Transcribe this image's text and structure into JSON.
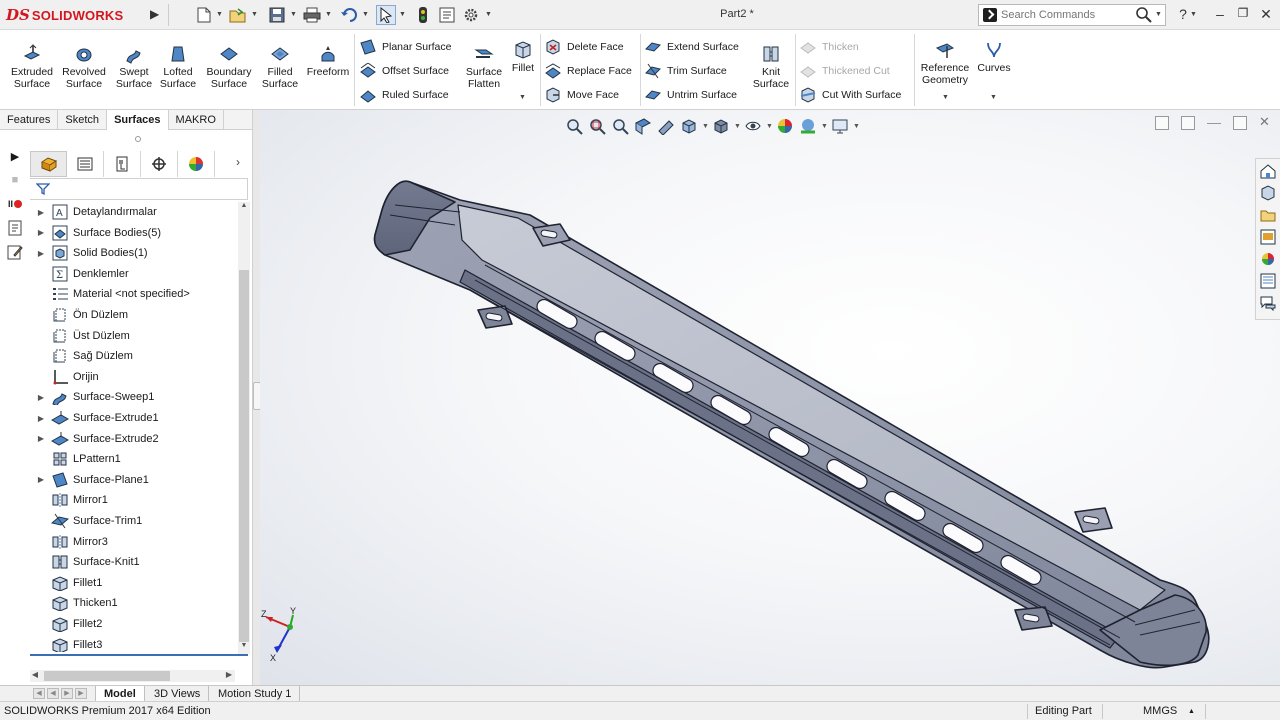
{
  "app": {
    "logo_prefix": "DS",
    "logo_text": "SOLIDWORKS",
    "document_title": "Part2 *",
    "search_placeholder": "Search Commands"
  },
  "ribbon": {
    "big_tools": [
      {
        "label": "Extruded Surface",
        "icon": "extruded-surface-icon"
      },
      {
        "label": "Revolved Surface",
        "icon": "revolved-surface-icon"
      },
      {
        "label": "Swept Surface",
        "icon": "swept-surface-icon"
      },
      {
        "label": "Lofted Surface",
        "icon": "lofted-surface-icon"
      },
      {
        "label": "Boundary Surface",
        "icon": "boundary-surface-icon"
      },
      {
        "label": "Filled Surface",
        "icon": "filled-surface-icon"
      },
      {
        "label": "Freeform",
        "icon": "freeform-icon"
      }
    ],
    "group1": [
      "Planar Surface",
      "Offset Surface",
      "Ruled Surface"
    ],
    "surface_flatten": "Surface Flatten",
    "fillet": "Fillet",
    "group2": [
      "Delete Face",
      "Replace Face",
      "Move Face"
    ],
    "group3": [
      "Extend Surface",
      "Trim Surface",
      "Untrim Surface"
    ],
    "knit_surface": "Knit Surface",
    "group4": [
      "Thicken",
      "Thickened Cut",
      "Cut With Surface"
    ],
    "reference_geometry": "Reference Geometry",
    "curves": "Curves"
  },
  "command_tabs": [
    {
      "label": "Features",
      "active": false
    },
    {
      "label": "Sketch",
      "active": false
    },
    {
      "label": "Surfaces",
      "active": true
    },
    {
      "label": "MAKRO",
      "active": false
    }
  ],
  "feature_tree": [
    {
      "label": "Detaylandırmalar",
      "expandable": true,
      "icon": "annotations-icon"
    },
    {
      "label": "Surface Bodies(5)",
      "expandable": true,
      "icon": "surface-bodies-icon"
    },
    {
      "label": "Solid Bodies(1)",
      "expandable": true,
      "icon": "solid-bodies-icon"
    },
    {
      "label": "Denklemler",
      "expandable": false,
      "icon": "equations-icon"
    },
    {
      "label": "Material <not specified>",
      "expandable": false,
      "icon": "material-icon"
    },
    {
      "label": "Ön Düzlem",
      "expandable": false,
      "icon": "plane-icon"
    },
    {
      "label": "Üst Düzlem",
      "expandable": false,
      "icon": "plane-icon"
    },
    {
      "label": "Sağ Düzlem",
      "expandable": false,
      "icon": "plane-icon"
    },
    {
      "label": "Orijin",
      "expandable": false,
      "icon": "origin-icon"
    },
    {
      "label": "Surface-Sweep1",
      "expandable": true,
      "icon": "sweep-feature-icon"
    },
    {
      "label": "Surface-Extrude1",
      "expandable": true,
      "icon": "extrude-feature-icon"
    },
    {
      "label": "Surface-Extrude2",
      "expandable": true,
      "icon": "extrude-feature-icon"
    },
    {
      "label": "LPattern1",
      "expandable": false,
      "icon": "linear-pattern-icon"
    },
    {
      "label": "Surface-Plane1",
      "expandable": true,
      "icon": "planar-surface-icon"
    },
    {
      "label": "Mirror1",
      "expandable": false,
      "icon": "mirror-icon"
    },
    {
      "label": "Surface-Trim1",
      "expandable": false,
      "icon": "trim-icon"
    },
    {
      "label": "Mirror3",
      "expandable": false,
      "icon": "mirror-icon"
    },
    {
      "label": "Surface-Knit1",
      "expandable": false,
      "icon": "knit-icon"
    },
    {
      "label": "Fillet1",
      "expandable": false,
      "icon": "fillet-icon"
    },
    {
      "label": "Thicken1",
      "expandable": false,
      "icon": "thicken-icon"
    },
    {
      "label": "Fillet2",
      "expandable": false,
      "icon": "fillet-icon"
    },
    {
      "label": "Fillet3",
      "expandable": false,
      "icon": "fillet-icon"
    }
  ],
  "triad": {
    "x": "X",
    "y": "Y",
    "z": "Z"
  },
  "bottom_tabs": [
    {
      "label": "Model",
      "active": true
    },
    {
      "label": "3D Views",
      "active": false
    },
    {
      "label": "Motion Study 1",
      "active": false
    }
  ],
  "status": {
    "edition": "SOLIDWORKS Premium 2017 x64 Edition",
    "mode": "Editing Part",
    "units": "MMGS"
  },
  "colors": {
    "brand": "#d4171e",
    "model_face": "#8d93a6",
    "accent": "#3a6fb4"
  }
}
